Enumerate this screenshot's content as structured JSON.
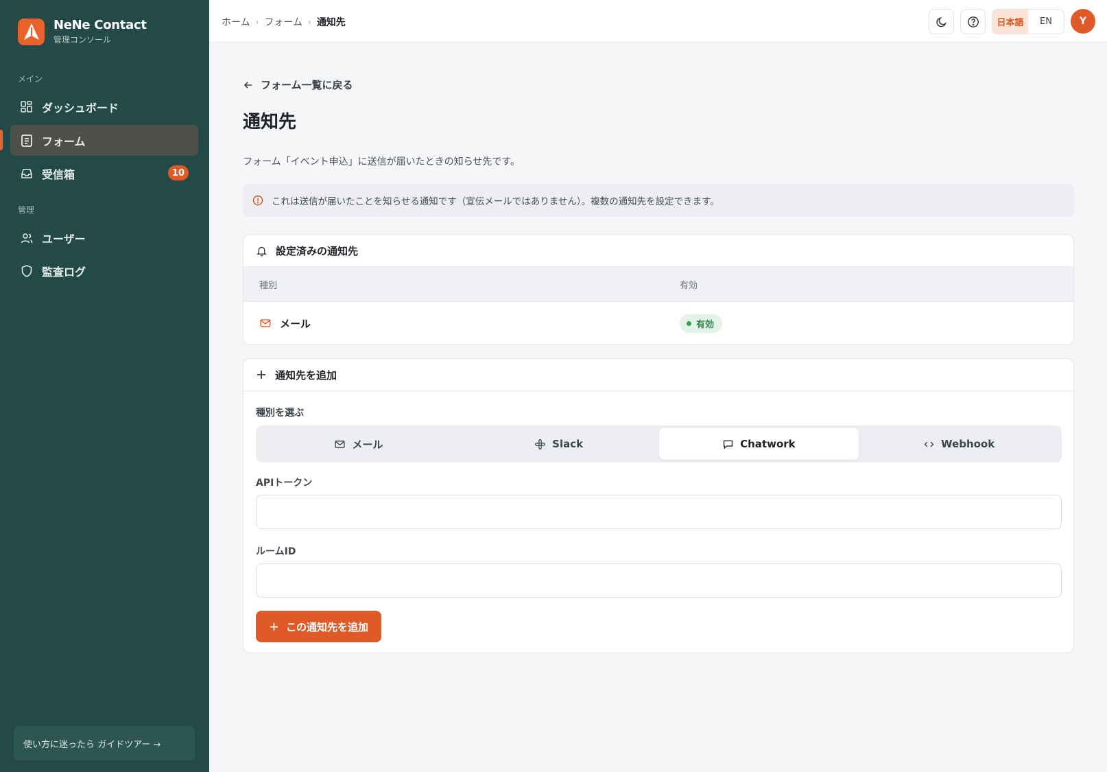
{
  "brand": {
    "name": "NeNe Contact",
    "subtitle": "管理コンソール"
  },
  "sidebar": {
    "main_label": "メイン",
    "admin_label": "管理",
    "items": [
      {
        "label": "ダッシュボード",
        "icon": "dashboard-icon"
      },
      {
        "label": "フォーム",
        "icon": "form-icon",
        "active": true
      },
      {
        "label": "受信箱",
        "icon": "inbox-icon",
        "badge": "10"
      },
      {
        "label": "ユーザー",
        "icon": "users-icon"
      },
      {
        "label": "監査ログ",
        "icon": "shield-icon"
      }
    ],
    "guide": "使い方に迷ったら ガイドツアー →"
  },
  "header": {
    "breadcrumbs": [
      "ホーム",
      "フォーム",
      "通知先"
    ],
    "lang_ja": "日本語",
    "lang_en": "EN",
    "avatar_initial": "Y"
  },
  "page": {
    "back": "フォーム一覧に戻る",
    "title": "通知先",
    "description": "フォーム「イベント申込」に送信が届いたときの知らせ先です。",
    "notice": "これは送信が届いたことを知らせる通知です（宣伝メールではありません）。複数の通知先を設定できます。"
  },
  "configured": {
    "title": "設定済みの通知先",
    "col_type": "種別",
    "col_enabled": "有効",
    "rows": [
      {
        "type": "メール",
        "status": "有効"
      }
    ]
  },
  "add": {
    "title": "通知先を追加",
    "type_label": "種別を選ぶ",
    "types": [
      "メール",
      "Slack",
      "Chatwork",
      "Webhook"
    ],
    "selected_type": "Chatwork",
    "api_token_label": "APIトークン",
    "api_token_value": "",
    "room_id_label": "ルームID",
    "room_id_value": "",
    "submit": "この通知先を追加"
  },
  "colors": {
    "accent": "#e05a28",
    "sidebar": "#234a47",
    "success": "#2f8a49"
  }
}
